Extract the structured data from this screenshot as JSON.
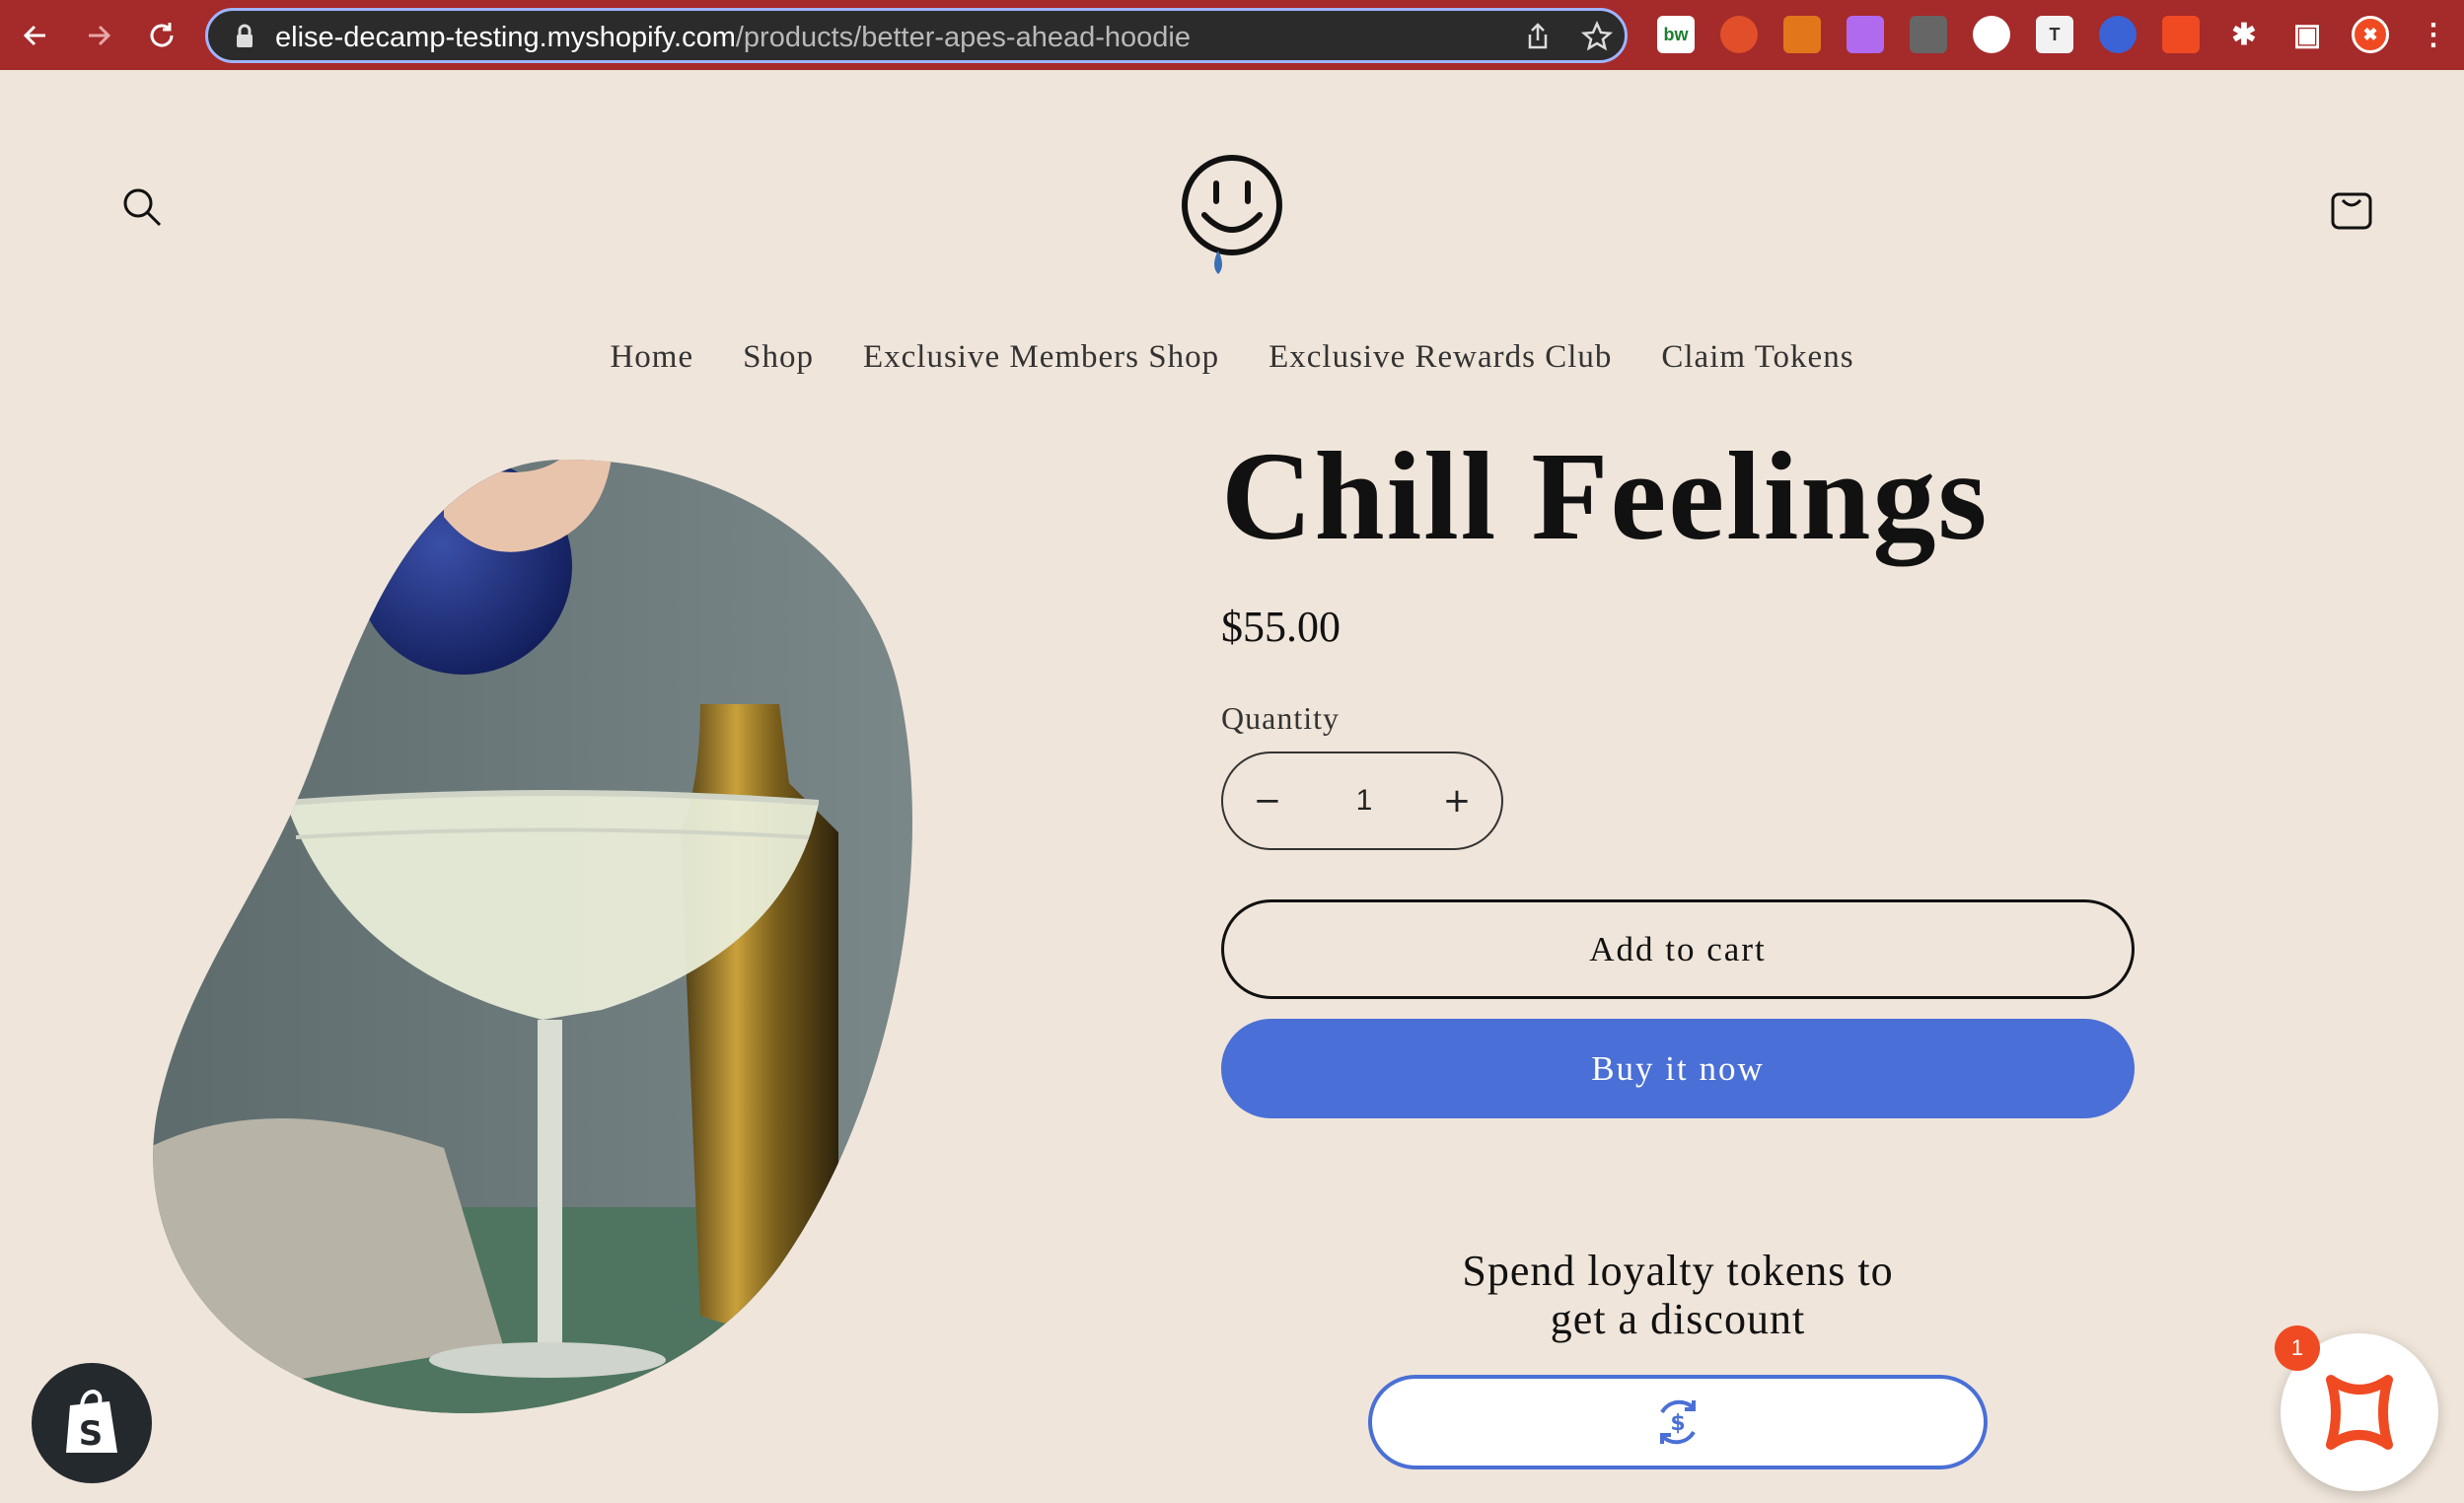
{
  "browser": {
    "url_host": "elise-decamp-testing.myshopify.com",
    "url_path": "/products/better-apes-ahead-hoodie",
    "extensions": [
      {
        "name": "bw-extension-icon",
        "label": "bw",
        "color": "#ffffff",
        "text_color": "#1a7f2e"
      },
      {
        "name": "swirl-extension-icon",
        "label": "",
        "color": "#e04e2a"
      },
      {
        "name": "metamask-extension-icon",
        "label": "",
        "color": "#e2761b"
      },
      {
        "name": "gradient-extension-icon",
        "label": "",
        "color": "#b06af0"
      },
      {
        "name": "pen-extension-icon",
        "label": "",
        "color": "#666666"
      },
      {
        "name": "lock-extension-icon",
        "label": "",
        "color": "#ffffff"
      },
      {
        "name": "t-extension-icon",
        "label": "T",
        "color": "#f2f2f2",
        "text_color": "#333333"
      },
      {
        "name": "circle-extension-icon",
        "label": "",
        "color": "#3b63d6"
      },
      {
        "name": "x-extension-icon",
        "label": "",
        "color": "#f04a23"
      },
      {
        "name": "puzzle-extension-icon",
        "label": "",
        "color": "#ffffff"
      },
      {
        "name": "sidepanel-icon",
        "label": "",
        "color": "#ffffff"
      },
      {
        "name": "profile-avatar-icon",
        "label": "",
        "color": "#f04a23"
      },
      {
        "name": "kebab-menu-icon",
        "label": "",
        "color": "#ffffff"
      }
    ]
  },
  "nav": {
    "items": [
      "Home",
      "Shop",
      "Exclusive Members Shop",
      "Exclusive Rewards Club",
      "Claim Tokens"
    ]
  },
  "product": {
    "title": "Chill Feelings",
    "price": "$55.00",
    "quantity_label": "Quantity",
    "quantity": "1",
    "decrement": "−",
    "increment": "+",
    "add_to_cart": "Add to cart",
    "buy_now": "Buy it now"
  },
  "loyalty": {
    "heading_line1": "Spend loyalty tokens to",
    "heading_line2": "get a discount"
  },
  "widget": {
    "notification_count": "1"
  },
  "colors": {
    "accent": "#4a6fd6",
    "brand_orange": "#f04a23",
    "background": "#efe5da",
    "chrome": "#a52a2a"
  }
}
